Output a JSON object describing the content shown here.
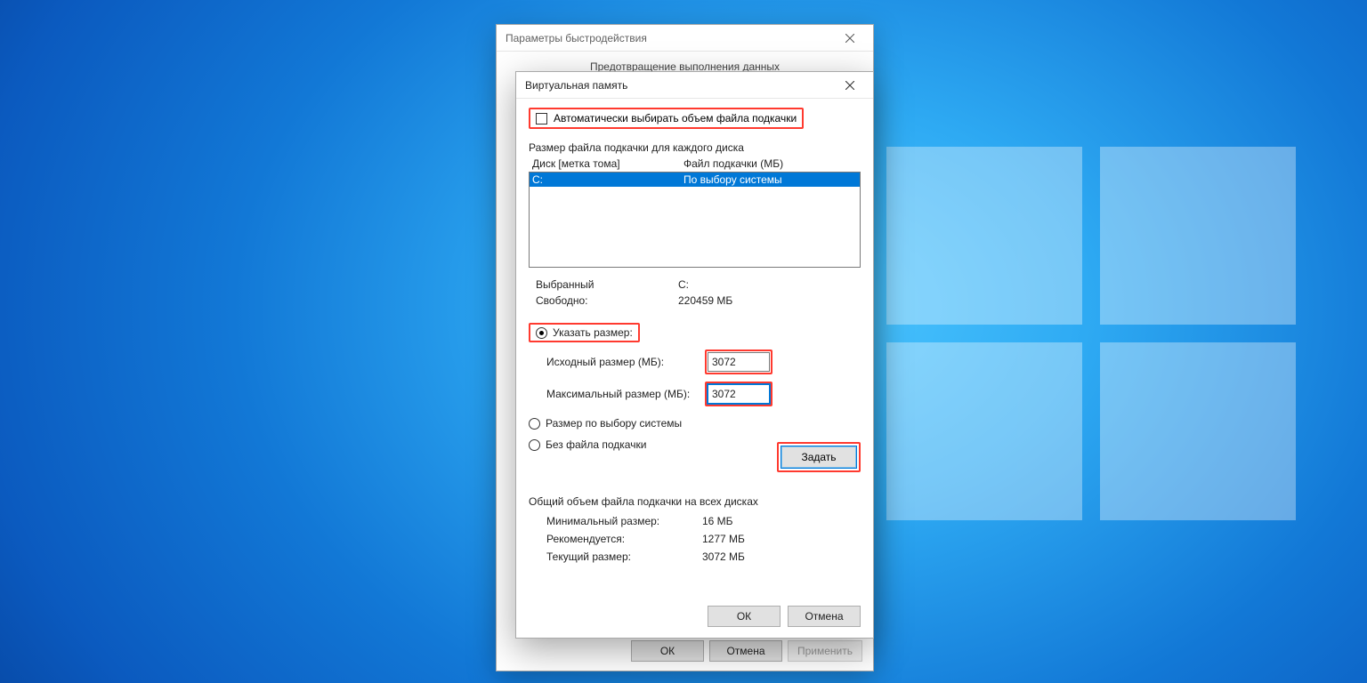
{
  "perf_dialog": {
    "title": "Параметры быстродействия",
    "tab_label": "Предотвращение выполнения данных",
    "ok": "ОК",
    "cancel": "Отмена",
    "apply": "Применить"
  },
  "vm_dialog": {
    "title": "Виртуальная память",
    "auto_checkbox": "Автоматически выбирать объем файла подкачки",
    "section_each_drive": "Размер файла подкачки для каждого диска",
    "col_drive": "Диск [метка тома]",
    "col_paging": "Файл подкачки (МБ)",
    "drive_label": "C:",
    "drive_value": "По выбору системы",
    "selected_label": "Выбранный",
    "selected_value": "C:",
    "free_label": "Свободно:",
    "free_value": "220459 МБ",
    "radio_custom": "Указать размер:",
    "initial_label": "Исходный размер (МБ):",
    "initial_value": "3072",
    "max_label": "Максимальный размер (МБ):",
    "max_value": "3072",
    "radio_system": "Размер по выбору системы",
    "radio_none": "Без файла подкачки",
    "set_btn": "Задать",
    "totals_header": "Общий объем файла подкачки на всех дисках",
    "min_label": "Минимальный размер:",
    "min_value": "16 МБ",
    "rec_label": "Рекомендуется:",
    "rec_value": "1277 МБ",
    "cur_label": "Текущий размер:",
    "cur_value": "3072 МБ",
    "ok": "ОК",
    "cancel": "Отмена"
  }
}
